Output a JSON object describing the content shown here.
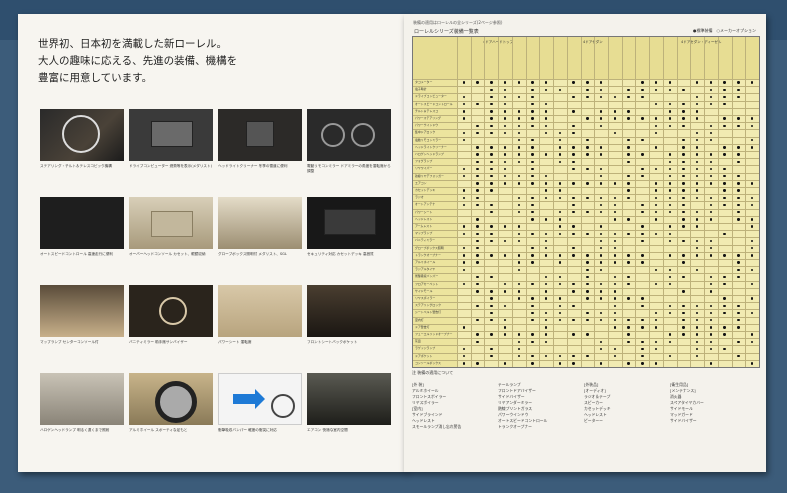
{
  "left_page": {
    "headline_lines": [
      "世界初、日本初を満載した新ローレル。",
      "大人の趣味に応える、先進の装備、機構を",
      "豊富に用意しています。"
    ],
    "top_note": "装備の適用はローレルの全シリーズ(2ページ参照)"
  },
  "features": [
    {
      "caption": "ステアリング・チルト＆テレスコピック機構"
    },
    {
      "caption": "ドライブコンピューター 燃費等を表示(メダリスト)"
    },
    {
      "caption": "ヘッドライトクリーナー 冬季の雪道に便利"
    },
    {
      "caption": "電動リモコンミラー ドアミラーの角度を運転席から調整"
    },
    {
      "caption": "オートスピードコントロール 高速走行に便利"
    },
    {
      "caption": "オーバーヘッドコンソール カセット、眼鏡収納"
    },
    {
      "caption": "グローブボックス照明付 メダリスト、SGL"
    },
    {
      "caption": "セキュリティ対応 カセットデッキ 高音質"
    },
    {
      "caption": "マップランプ センターコンソール付"
    },
    {
      "caption": "バニティミラー 助手席サンバイザー"
    },
    {
      "caption": "パワーシート 運転席"
    },
    {
      "caption": "フロントシートバックポケット"
    },
    {
      "caption": "ハロゲンヘッドランプ 明るく遠くまで照射"
    },
    {
      "caption": "アルミホイール スポーティな足もと"
    },
    {
      "caption": "衝撃吸収バンパー 軽度の衝突に対応"
    },
    {
      "caption": "エアコン 快適な室内空間"
    }
  ],
  "right_page": {
    "title": "ローレルシリーズ装備一覧表",
    "legend": "●標準装備　○メーカーオプション",
    "col_groups": [
      "4ドアハードトップ",
      "4ドアセダン",
      "4ドアセダン・ディーゼル"
    ],
    "row_labels": [
      "タコメーター",
      "電子時計",
      "ドライブコンピューター",
      "オートスピードコントロール",
      "チルト＆テレスコ",
      "パワーステアリング",
      "パワーウインドウ",
      "集中ドアロック",
      "電動リモコンミラー",
      "ヘッドライトクリーナー",
      "ハロゲンヘッドランプ",
      "フォグランプ",
      "リヤワイパー",
      "熱線リヤデフォッガー",
      "エアコン",
      "カセットデッキ",
      "ラジオ",
      "オートアンテナ",
      "パワーシート",
      "ヘッドレスト",
      "アームレスト",
      "マップランプ",
      "バニティミラー",
      "グローブボックス照明",
      "トランクオープナー",
      "アルミホイール",
      "ラジアルタイヤ",
      "衝撃吸収バンパー",
      "フロアカーペット",
      "サイドモール",
      "リヤスポイラー",
      "ステアリングロック",
      "シートベルト警告灯",
      "室内灯",
      "ドア警告灯",
      "フューエルリッドオープナー",
      "灰皿",
      "ラゲッジランプ",
      "ドアポケット",
      "コンソールボックス"
    ],
    "notes_title": "注 装備の適用について",
    "notes": [
      "[外 装]\nアルミホイール\nフロントスポイラー\nリヤスポイラー\n[室内]\nサイドブラインド\nヘッドレスト\nスモールランプ消し忘れ警告",
      "テールランプ\nフロントドアバイザー\nサイドバイザー\nリヤアンダーミラー\n熱線プリントガラス\nパワーウインドウ\nオートスピードコントロール\nトランクオープナー",
      "[外装品]\n[オーディオ]\nラジオ＆テープ\nスピーカー\nカセットデッキ\nヘッドレスト\nピーターー",
      "[衛生用品]\n[メンテナンス]\n消火器\nスペアタイヤカバー\nサイドモール\nマッドガード\nサイドバイザー"
    ]
  }
}
